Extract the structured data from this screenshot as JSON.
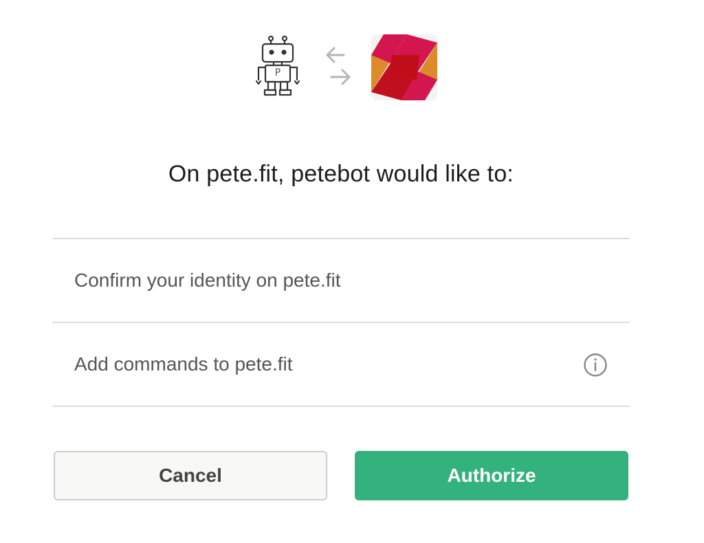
{
  "header": {
    "bot_logo_icon": "robot-icon",
    "bot_logo_letter": "P",
    "swap_icon": "arrows-swap-icon",
    "app_logo_icon": "workspace-logo-icon",
    "colors": {
      "app_logo_red": "#c0392b",
      "app_logo_orange": "#dc8a2a",
      "app_logo_pink": "#d4164f"
    }
  },
  "heading": "On pete.fit, petebot would like to:",
  "permissions": [
    {
      "label": "Confirm your identity on pete.fit",
      "has_info": false
    },
    {
      "label": "Add commands to pete.fit",
      "has_info": true,
      "info_icon": "info-icon"
    }
  ],
  "buttons": {
    "cancel_label": "Cancel",
    "authorize_label": "Authorize"
  },
  "colors": {
    "authorize_bg": "#34b27d",
    "divider": "#dddddd"
  }
}
